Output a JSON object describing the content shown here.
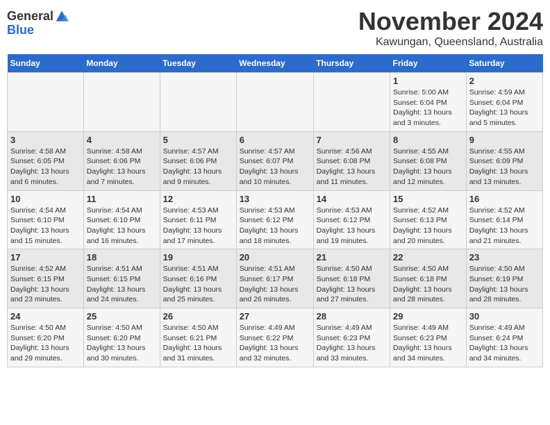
{
  "logo": {
    "general": "General",
    "blue": "Blue"
  },
  "title": "November 2024",
  "subtitle": "Kawungan, Queensland, Australia",
  "days_header": [
    "Sunday",
    "Monday",
    "Tuesday",
    "Wednesday",
    "Thursday",
    "Friday",
    "Saturday"
  ],
  "weeks": [
    [
      {
        "day": "",
        "info": ""
      },
      {
        "day": "",
        "info": ""
      },
      {
        "day": "",
        "info": ""
      },
      {
        "day": "",
        "info": ""
      },
      {
        "day": "",
        "info": ""
      },
      {
        "day": "1",
        "info": "Sunrise: 5:00 AM\nSunset: 6:04 PM\nDaylight: 13 hours\nand 3 minutes."
      },
      {
        "day": "2",
        "info": "Sunrise: 4:59 AM\nSunset: 6:04 PM\nDaylight: 13 hours\nand 5 minutes."
      }
    ],
    [
      {
        "day": "3",
        "info": "Sunrise: 4:58 AM\nSunset: 6:05 PM\nDaylight: 13 hours\nand 6 minutes."
      },
      {
        "day": "4",
        "info": "Sunrise: 4:58 AM\nSunset: 6:06 PM\nDaylight: 13 hours\nand 7 minutes."
      },
      {
        "day": "5",
        "info": "Sunrise: 4:57 AM\nSunset: 6:06 PM\nDaylight: 13 hours\nand 9 minutes."
      },
      {
        "day": "6",
        "info": "Sunrise: 4:57 AM\nSunset: 6:07 PM\nDaylight: 13 hours\nand 10 minutes."
      },
      {
        "day": "7",
        "info": "Sunrise: 4:56 AM\nSunset: 6:08 PM\nDaylight: 13 hours\nand 11 minutes."
      },
      {
        "day": "8",
        "info": "Sunrise: 4:55 AM\nSunset: 6:08 PM\nDaylight: 13 hours\nand 12 minutes."
      },
      {
        "day": "9",
        "info": "Sunrise: 4:55 AM\nSunset: 6:09 PM\nDaylight: 13 hours\nand 13 minutes."
      }
    ],
    [
      {
        "day": "10",
        "info": "Sunrise: 4:54 AM\nSunset: 6:10 PM\nDaylight: 13 hours\nand 15 minutes."
      },
      {
        "day": "11",
        "info": "Sunrise: 4:54 AM\nSunset: 6:10 PM\nDaylight: 13 hours\nand 16 minutes."
      },
      {
        "day": "12",
        "info": "Sunrise: 4:53 AM\nSunset: 6:11 PM\nDaylight: 13 hours\nand 17 minutes."
      },
      {
        "day": "13",
        "info": "Sunrise: 4:53 AM\nSunset: 6:12 PM\nDaylight: 13 hours\nand 18 minutes."
      },
      {
        "day": "14",
        "info": "Sunrise: 4:53 AM\nSunset: 6:12 PM\nDaylight: 13 hours\nand 19 minutes."
      },
      {
        "day": "15",
        "info": "Sunrise: 4:52 AM\nSunset: 6:13 PM\nDaylight: 13 hours\nand 20 minutes."
      },
      {
        "day": "16",
        "info": "Sunrise: 4:52 AM\nSunset: 6:14 PM\nDaylight: 13 hours\nand 21 minutes."
      }
    ],
    [
      {
        "day": "17",
        "info": "Sunrise: 4:52 AM\nSunset: 6:15 PM\nDaylight: 13 hours\nand 23 minutes."
      },
      {
        "day": "18",
        "info": "Sunrise: 4:51 AM\nSunset: 6:15 PM\nDaylight: 13 hours\nand 24 minutes."
      },
      {
        "day": "19",
        "info": "Sunrise: 4:51 AM\nSunset: 6:16 PM\nDaylight: 13 hours\nand 25 minutes."
      },
      {
        "day": "20",
        "info": "Sunrise: 4:51 AM\nSunset: 6:17 PM\nDaylight: 13 hours\nand 26 minutes."
      },
      {
        "day": "21",
        "info": "Sunrise: 4:50 AM\nSunset: 6:18 PM\nDaylight: 13 hours\nand 27 minutes."
      },
      {
        "day": "22",
        "info": "Sunrise: 4:50 AM\nSunset: 6:18 PM\nDaylight: 13 hours\nand 28 minutes."
      },
      {
        "day": "23",
        "info": "Sunrise: 4:50 AM\nSunset: 6:19 PM\nDaylight: 13 hours\nand 28 minutes."
      }
    ],
    [
      {
        "day": "24",
        "info": "Sunrise: 4:50 AM\nSunset: 6:20 PM\nDaylight: 13 hours\nand 29 minutes."
      },
      {
        "day": "25",
        "info": "Sunrise: 4:50 AM\nSunset: 6:20 PM\nDaylight: 13 hours\nand 30 minutes."
      },
      {
        "day": "26",
        "info": "Sunrise: 4:50 AM\nSunset: 6:21 PM\nDaylight: 13 hours\nand 31 minutes."
      },
      {
        "day": "27",
        "info": "Sunrise: 4:49 AM\nSunset: 6:22 PM\nDaylight: 13 hours\nand 32 minutes."
      },
      {
        "day": "28",
        "info": "Sunrise: 4:49 AM\nSunset: 6:23 PM\nDaylight: 13 hours\nand 33 minutes."
      },
      {
        "day": "29",
        "info": "Sunrise: 4:49 AM\nSunset: 6:23 PM\nDaylight: 13 hours\nand 34 minutes."
      },
      {
        "day": "30",
        "info": "Sunrise: 4:49 AM\nSunset: 6:24 PM\nDaylight: 13 hours\nand 34 minutes."
      }
    ]
  ]
}
